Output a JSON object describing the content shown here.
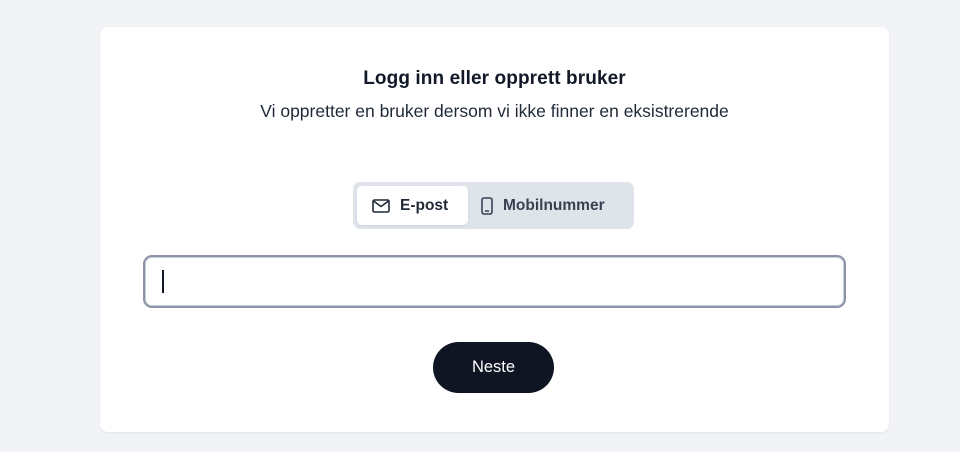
{
  "login": {
    "title": "Logg inn eller opprett bruker",
    "subtitle": "Vi oppretter en bruker dersom vi ikke finner en eksistrerende",
    "tabs": [
      {
        "label": "E-post",
        "icon": "mail-icon",
        "active": true
      },
      {
        "label": "Mobilnummer",
        "icon": "phone-icon",
        "active": false
      }
    ],
    "input": {
      "value": "",
      "placeholder": ""
    },
    "next_label": "Neste"
  },
  "colors": {
    "background": "#f1f3f6",
    "card": "#ffffff",
    "tab_track": "#dfe3ea",
    "button": "#0f1523",
    "input_border": "#8a94a6"
  }
}
